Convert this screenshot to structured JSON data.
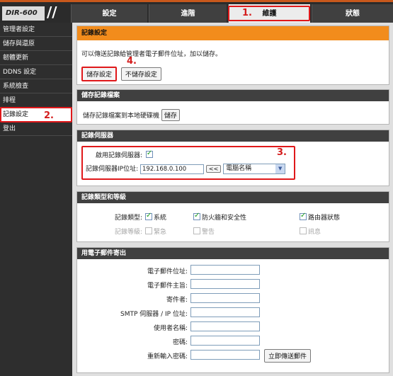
{
  "model": "DIR-600",
  "tabs": [
    "設定",
    "進階",
    "維護",
    "狀態"
  ],
  "annotations": {
    "one": "1.",
    "two": "2.",
    "three": "3.",
    "four": "4."
  },
  "sidebar": {
    "items": [
      "管理者設定",
      "儲存與還原",
      "韌體更新",
      "DDNS 設定",
      "系統檢查",
      "排程",
      "記錄設定",
      "登出"
    ]
  },
  "log_settings": {
    "title": "記錄設定",
    "description": "可以傳送記錄給管理者電子郵件位址，加以儲存。",
    "save_button": "儲存設定",
    "dont_save_button": "不儲存設定"
  },
  "save_log": {
    "title": "儲存記錄檔案",
    "label": "儲存記錄檔案到本地硬碟機",
    "button": "儲存"
  },
  "syslog": {
    "title": "記錄伺服器",
    "enable_label": "啟用記錄伺服器:",
    "ip_label": "記錄伺服器IP位址:",
    "ip_value": "192.168.0.100",
    "copy_button": "<<",
    "computer_name_option": "電腦名稱"
  },
  "log_type": {
    "title": "記錄類型和等級",
    "type_label": "記錄類型:",
    "types": [
      "系統",
      "防火牆和安全性",
      "路由器狀態"
    ],
    "level_label": "記錄等級:",
    "levels": [
      "緊急",
      "警告",
      "訊息"
    ]
  },
  "email": {
    "title": "用電子郵件寄出",
    "fields": [
      "電子郵件位址:",
      "電子郵件主旨:",
      "寄件者:",
      "SMTP 伺服器 / IP 位址:",
      "使用者名稱:",
      "密碼:",
      "重新輸入密碼:"
    ],
    "send_now_button": "立即傳送郵件"
  }
}
